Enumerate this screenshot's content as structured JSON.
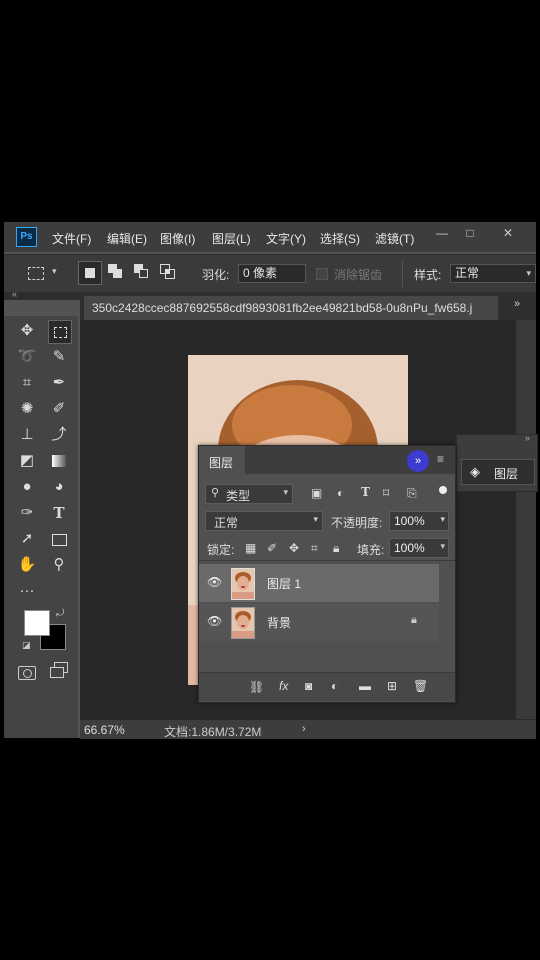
{
  "app": {
    "logo": "Ps"
  },
  "menubar": {
    "items": [
      "文件(F)",
      "编辑(E)",
      "图像(I)",
      "图层(L)",
      "文字(Y)",
      "选择(S)",
      "滤镜(T)"
    ],
    "window_buttons": [
      "—",
      "□",
      "✕"
    ]
  },
  "options": {
    "feather_label": "羽化:",
    "feather_value": "0 像素",
    "antialias_label": "消除锯齿",
    "style_label": "样式:",
    "style_value": "正常"
  },
  "document": {
    "tab_title": "350c2428ccec887692558cdf9893081fb2ee49821bd58-0u8nPu_fw658.j",
    "zoom": "66.67%",
    "doc_size": "文档:1.86M/3.72M"
  },
  "layers_panel": {
    "title": "图层",
    "filter_kind": "类型",
    "blend_mode": "正常",
    "opacity_label": "不透明度:",
    "opacity_value": "100%",
    "lock_label": "锁定:",
    "fill_label": "填充:",
    "fill_value": "100%",
    "layers": [
      {
        "name": "图层 1",
        "selected": true,
        "locked": false
      },
      {
        "name": "背景",
        "selected": false,
        "locked": true
      }
    ]
  },
  "side_panel": {
    "label": "图层"
  },
  "colors": {
    "accent_circle": "#3b3bd0",
    "panel_bg": "#505050",
    "selected_row": "#6a6a6a"
  }
}
